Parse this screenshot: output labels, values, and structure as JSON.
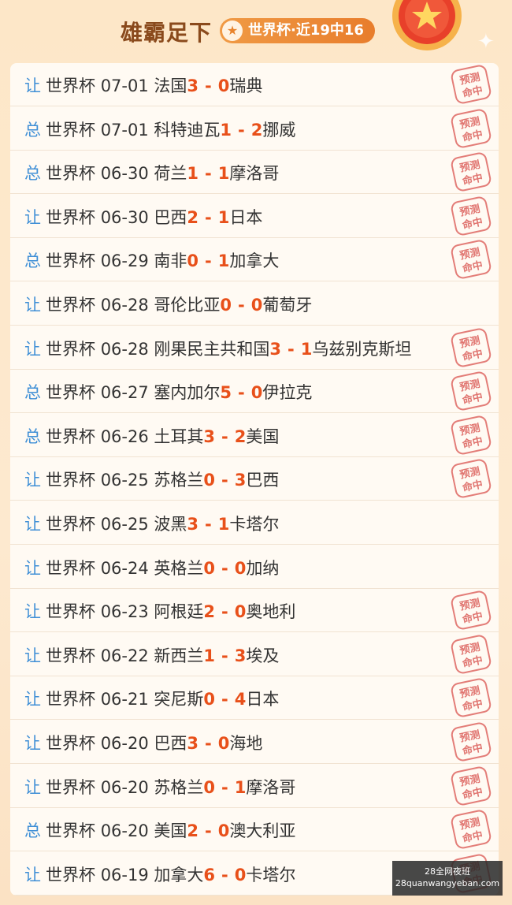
{
  "header": {
    "title": "雄霸足下",
    "badge": "世界杯·近19中16"
  },
  "stamp_text": [
    "预测",
    "命中"
  ],
  "rows": [
    {
      "tag": "让",
      "league": "世界杯",
      "date": "07-01",
      "home": "法国",
      "home_score": "3",
      "away_score": "0",
      "away": "瑞典",
      "hit": true
    },
    {
      "tag": "总",
      "league": "世界杯",
      "date": "07-01",
      "home": "科特迪瓦",
      "home_score": "1",
      "away_score": "2",
      "away": "挪威",
      "hit": true
    },
    {
      "tag": "总",
      "league": "世界杯",
      "date": "06-30",
      "home": "荷兰",
      "home_score": "1",
      "away_score": "1",
      "away": "摩洛哥",
      "hit": true
    },
    {
      "tag": "让",
      "league": "世界杯",
      "date": "06-30",
      "home": "巴西",
      "home_score": "2",
      "away_score": "1",
      "away": "日本",
      "hit": true
    },
    {
      "tag": "总",
      "league": "世界杯",
      "date": "06-29",
      "home": "南非",
      "home_score": "0",
      "away_score": "1",
      "away": "加拿大",
      "hit": true
    },
    {
      "tag": "让",
      "league": "世界杯",
      "date": "06-28",
      "home": "哥伦比亚",
      "home_score": "0",
      "away_score": "0",
      "away": "葡萄牙",
      "hit": false
    },
    {
      "tag": "让",
      "league": "世界杯",
      "date": "06-28",
      "home": "刚果民主共和国",
      "home_score": "3",
      "away_score": "1",
      "away": "乌兹别克斯坦",
      "hit": true
    },
    {
      "tag": "总",
      "league": "世界杯",
      "date": "06-27",
      "home": "塞内加尔",
      "home_score": "5",
      "away_score": "0",
      "away": "伊拉克",
      "hit": true
    },
    {
      "tag": "总",
      "league": "世界杯",
      "date": "06-26",
      "home": "土耳其",
      "home_score": "3",
      "away_score": "2",
      "away": "美国",
      "hit": true
    },
    {
      "tag": "让",
      "league": "世界杯",
      "date": "06-25",
      "home": "苏格兰",
      "home_score": "0",
      "away_score": "3",
      "away": "巴西",
      "hit": true
    },
    {
      "tag": "让",
      "league": "世界杯",
      "date": "06-25",
      "home": "波黑",
      "home_score": "3",
      "away_score": "1",
      "away": "卡塔尔",
      "hit": false
    },
    {
      "tag": "让",
      "league": "世界杯",
      "date": "06-24",
      "home": "英格兰",
      "home_score": "0",
      "away_score": "0",
      "away": "加纳",
      "hit": false
    },
    {
      "tag": "让",
      "league": "世界杯",
      "date": "06-23",
      "home": "阿根廷",
      "home_score": "2",
      "away_score": "0",
      "away": "奥地利",
      "hit": true
    },
    {
      "tag": "让",
      "league": "世界杯",
      "date": "06-22",
      "home": "新西兰",
      "home_score": "1",
      "away_score": "3",
      "away": "埃及",
      "hit": true
    },
    {
      "tag": "让",
      "league": "世界杯",
      "date": "06-21",
      "home": "突尼斯",
      "home_score": "0",
      "away_score": "4",
      "away": "日本",
      "hit": true
    },
    {
      "tag": "让",
      "league": "世界杯",
      "date": "06-20",
      "home": "巴西",
      "home_score": "3",
      "away_score": "0",
      "away": "海地",
      "hit": true
    },
    {
      "tag": "让",
      "league": "世界杯",
      "date": "06-20",
      "home": "苏格兰",
      "home_score": "0",
      "away_score": "1",
      "away": "摩洛哥",
      "hit": true
    },
    {
      "tag": "总",
      "league": "世界杯",
      "date": "06-20",
      "home": "美国",
      "home_score": "2",
      "away_score": "0",
      "away": "澳大利亚",
      "hit": true
    },
    {
      "tag": "让",
      "league": "世界杯",
      "date": "06-19",
      "home": "加拿大",
      "home_score": "6",
      "away_score": "0",
      "away": "卡塔尔",
      "hit": true
    }
  ],
  "watermark": {
    "line1": "28全网夜班",
    "line2": "28quanwangyeban.com"
  },
  "colors": {
    "accent": "#e8501a",
    "tag": "#3f8fd6",
    "title": "#8a4a1c",
    "badge": "#e87d2c",
    "stamp": "#d9534f"
  }
}
